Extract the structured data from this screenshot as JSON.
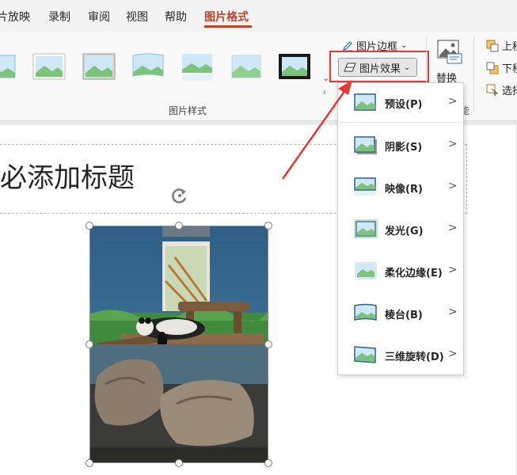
{
  "tabs": [
    {
      "label": "片放映",
      "active": false
    },
    {
      "label": "录制",
      "active": false
    },
    {
      "label": "审阅",
      "active": false
    },
    {
      "label": "视图",
      "active": false
    },
    {
      "label": "帮助",
      "active": false
    },
    {
      "label": "图片格式",
      "active": true
    }
  ],
  "ribbon": {
    "styles_group_label": "图片样式",
    "border_label": "图片边框",
    "effects_label": "图片效果",
    "replace_label": "替换",
    "replace_group_suffix": "能",
    "arrange": {
      "bring_forward": "上移",
      "send_backward": "下移",
      "selection": "选择"
    }
  },
  "slide": {
    "title_placeholder": "必添加标题"
  },
  "effects_menu": {
    "items": [
      {
        "label": "预设(P)",
        "icon": "preset-icon"
      },
      {
        "label": "阴影(S)",
        "icon": "shadow-icon"
      },
      {
        "label": "映像(R)",
        "icon": "reflection-icon"
      },
      {
        "label": "发光(G)",
        "icon": "glow-icon"
      },
      {
        "label": "柔化边缘(E)",
        "icon": "soft-edges-icon"
      },
      {
        "label": "棱台(B)",
        "icon": "bevel-icon"
      },
      {
        "label": "三维旋转(D)",
        "icon": "3d-rotation-icon"
      }
    ]
  },
  "colors": {
    "accent": "#b7472a",
    "highlight": "#e53935"
  }
}
